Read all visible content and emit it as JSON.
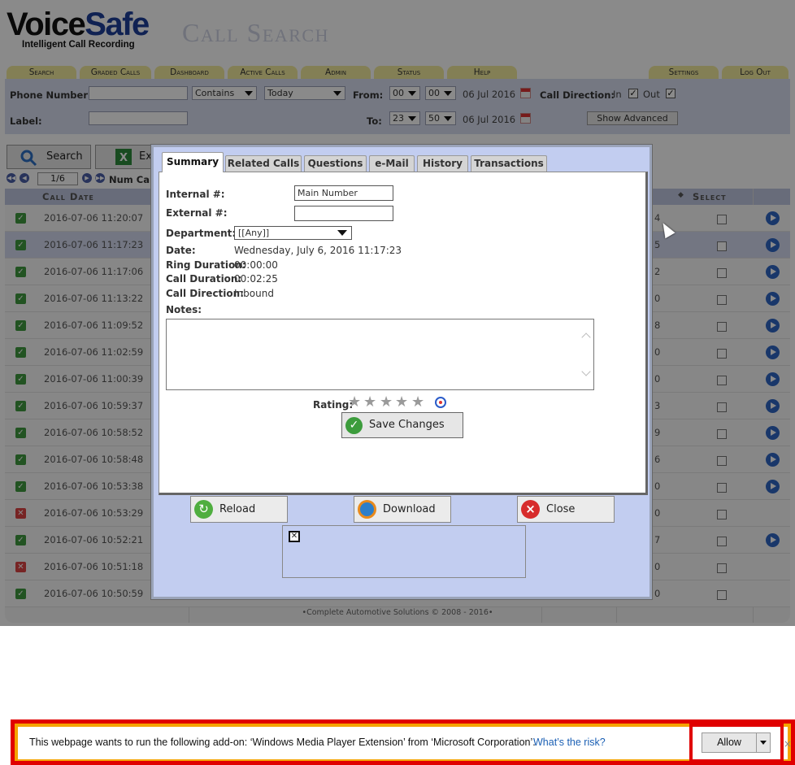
{
  "app": {
    "logo_voice": "Voice",
    "logo_safe": "Safe",
    "logo_tagline": "Intelligent Call Recording",
    "page_title": "Call Search"
  },
  "nav": [
    "Search",
    "Graded Calls",
    "Dashboard",
    "Active Calls",
    "Admin",
    "Status",
    "Help",
    "Settings",
    "Log Out"
  ],
  "search": {
    "phone_label": "Phone Number:",
    "match_mode": "Contains",
    "date_range": "Today",
    "from_label": "From:",
    "from_hour": "00",
    "from_min": "00",
    "from_date": "06 Jul 2016",
    "call_direction_label": "Call Direction:",
    "in_label": "In",
    "out_label": "Out",
    "label_label": "Label:",
    "to_label": "To:",
    "to_hour": "23",
    "to_min": "50",
    "to_date": "06 Jul 2016",
    "show_advanced": "Show Advanced"
  },
  "toolbar": {
    "search_label": "Search",
    "export_label": "Ex"
  },
  "pager": {
    "page": "1/6",
    "num_calls_label": "Num Call"
  },
  "grid": {
    "col_date": "Call Date",
    "col_select": "Select",
    "rows": [
      {
        "date": "2016-07-06 11:20:07",
        "status": "ok",
        "num": "4",
        "play": true
      },
      {
        "date": "2016-07-06 11:17:23",
        "status": "ok",
        "num": "5",
        "play": true
      },
      {
        "date": "2016-07-06 11:17:06",
        "status": "ok",
        "num": "2",
        "play": true
      },
      {
        "date": "2016-07-06 11:13:22",
        "status": "ok",
        "num": "0",
        "play": true
      },
      {
        "date": "2016-07-06 11:09:52",
        "status": "ok",
        "num": "8",
        "play": true
      },
      {
        "date": "2016-07-06 11:02:59",
        "status": "ok",
        "num": "0",
        "play": true
      },
      {
        "date": "2016-07-06 11:00:39",
        "status": "ok",
        "num": "0",
        "play": true
      },
      {
        "date": "2016-07-06 10:59:37",
        "status": "ok",
        "num": "3",
        "play": true
      },
      {
        "date": "2016-07-06 10:58:52",
        "status": "ok",
        "num": "9",
        "play": true
      },
      {
        "date": "2016-07-06 10:58:48",
        "status": "ok",
        "num": "6",
        "play": true
      },
      {
        "date": "2016-07-06 10:53:38",
        "status": "ok",
        "num": "0",
        "play": true
      },
      {
        "date": "2016-07-06 10:53:29",
        "status": "bad",
        "num": "0",
        "play": false
      },
      {
        "date": "2016-07-06 10:52:21",
        "status": "ok",
        "num": "7",
        "play": true
      },
      {
        "date": "2016-07-06 10:51:18",
        "status": "bad",
        "num": "0",
        "play": false
      },
      {
        "date": "2016-07-06 10:50:59",
        "status": "ok",
        "num": "0",
        "play": false
      }
    ],
    "footer": "•Complete Automotive Solutions © 2008 - 2016•"
  },
  "modal": {
    "tabs": [
      "Summary",
      "Related Calls",
      "Questions",
      "e-Mail",
      "History",
      "Transactions"
    ],
    "active_tab": "Summary",
    "internal_label": "Internal #:",
    "internal_value": "Main Number",
    "external_label": "External #:",
    "external_value": "",
    "department_label": "Department:",
    "department_value": "[[Any]]",
    "date_label": "Date:",
    "date_value": "Wednesday, July 6, 2016 11:17:23",
    "ring_label": "Ring Duration:",
    "ring_value": "00:00:00",
    "call_duration_label": "Call Duration:",
    "call_duration_value": "00:02:25",
    "call_direction_label": "Call Direction:",
    "call_direction_value": "Inbound",
    "notes_label": "Notes:",
    "rating_label": "Rating:",
    "rating_value": 0,
    "rating_max": 5,
    "save_label": "Save Changes",
    "reload_label": "Reload",
    "download_label": "Download",
    "close_label": "Close"
  },
  "notification": {
    "message": "This webpage wants to run the following add-on: ‘Windows Media Player Extension’ from ‘Microsoft Corporation’.",
    "link": "What’s the risk?",
    "allow_label": "Allow",
    "close_glyph": "×"
  },
  "colors": {
    "accent": "#1e3f9a",
    "nav_tab": "#f3eb9d",
    "highlight": "#e00000",
    "modal_bg": "#c2cdf0"
  }
}
